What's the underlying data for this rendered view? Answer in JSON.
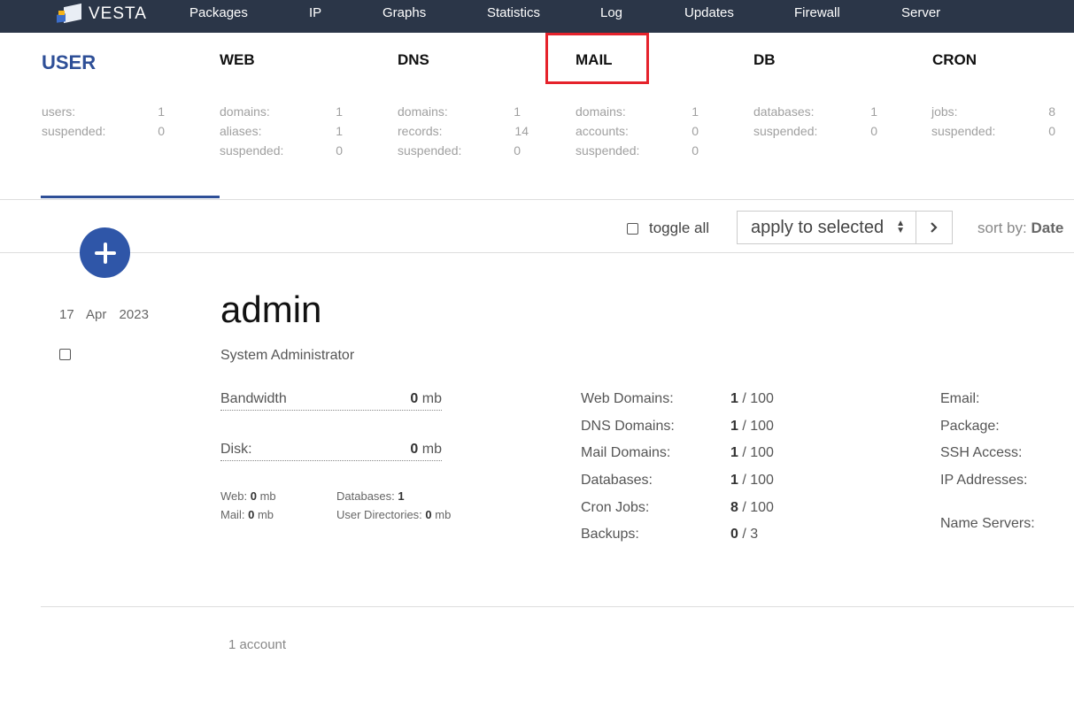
{
  "brand": "VESTA",
  "nav": [
    "Packages",
    "IP",
    "Graphs",
    "Statistics",
    "Log",
    "Updates",
    "Firewall",
    "Server"
  ],
  "categories": {
    "user": {
      "title": "USER",
      "stats": [
        [
          "users:",
          "1"
        ],
        [
          "suspended:",
          "0"
        ]
      ]
    },
    "web": {
      "title": "WEB",
      "stats": [
        [
          "domains:",
          "1"
        ],
        [
          "aliases:",
          "1"
        ],
        [
          "suspended:",
          "0"
        ]
      ]
    },
    "dns": {
      "title": "DNS",
      "stats": [
        [
          "domains:",
          "1"
        ],
        [
          "records:",
          "14"
        ],
        [
          "suspended:",
          "0"
        ]
      ]
    },
    "mail": {
      "title": "MAIL",
      "stats": [
        [
          "domains:",
          "1"
        ],
        [
          "accounts:",
          "0"
        ],
        [
          "suspended:",
          "0"
        ]
      ]
    },
    "db": {
      "title": "DB",
      "stats": [
        [
          "databases:",
          "1"
        ],
        [
          "suspended:",
          "0"
        ]
      ]
    },
    "cron": {
      "title": "CRON",
      "stats": [
        [
          "jobs:",
          "8"
        ],
        [
          "suspended:",
          "0"
        ]
      ]
    }
  },
  "toolbar": {
    "toggle_all": "toggle all",
    "bulk_action": "apply to selected",
    "sort_label": "sort by:",
    "sort_value": "Date"
  },
  "user": {
    "date_day": "17",
    "date_month": "Apr",
    "date_year": "2023",
    "username": "admin",
    "fullname": "System Administrator",
    "bandwidth_label": "Bandwidth",
    "bandwidth_value": "0",
    "disk_label": "Disk:",
    "disk_value": "0",
    "unit": "mb",
    "web_label": "Web:",
    "web_value": "0",
    "mail_label": "Mail:",
    "mail_value": "0",
    "databases_label": "Databases:",
    "databases_value": "1",
    "userdirs_label": "User Directories:",
    "userdirs_value": "0",
    "limits": [
      {
        "label": "Web Domains:",
        "used": "1",
        "max": "100"
      },
      {
        "label": "DNS Domains:",
        "used": "1",
        "max": "100"
      },
      {
        "label": "Mail Domains:",
        "used": "1",
        "max": "100"
      },
      {
        "label": "Databases:",
        "used": "1",
        "max": "100"
      },
      {
        "label": "Cron Jobs:",
        "used": "8",
        "max": "100"
      },
      {
        "label": "Backups:",
        "used": "0",
        "max": "3"
      }
    ],
    "info_labels": [
      "Email:",
      "Package:",
      "SSH Access:",
      "IP Addresses:",
      "Name Servers:"
    ]
  },
  "footer": {
    "count": "1 account"
  },
  "colors": {
    "topbar": "#2b3648",
    "accent": "#2e4f97",
    "highlight": "#e5222b"
  }
}
